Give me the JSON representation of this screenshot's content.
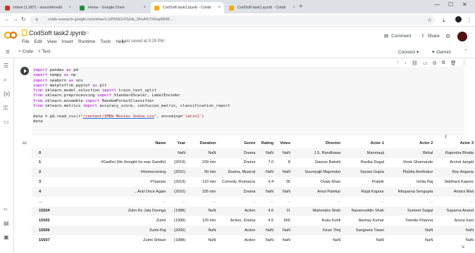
{
  "browser": {
    "tabs": [
      {
        "label": "Inbox (1,987) - ansuvbhredd",
        "fav_color": "#d93025",
        "active": false
      },
      {
        "label": "Home - Google Drive",
        "fav_color": "#1e8e3e",
        "active": false
      },
      {
        "label": "CodSoft task2.ipynb - Colab",
        "fav_color": "#f9ab00",
        "active": true
      },
      {
        "label": "CodSoft task1.ipynb - Colab",
        "fav_color": "#f9ab00",
        "active": false
      }
    ],
    "new_tab_icon": "+",
    "url": "colab.research.google.com/drive/1JzPM3GVOyHb_MroAfV7rRaqAB89…",
    "window_controls": [
      "—",
      "☐",
      "✕"
    ]
  },
  "colab": {
    "logo_color": "#f9ab00",
    "notebook_title": "CodSoft task2.ipynb",
    "menu": [
      "File",
      "Edit",
      "View",
      "Insert",
      "Runtime",
      "Tools",
      "Help"
    ],
    "last_saved": "Last saved at 9:29 PM",
    "comment_label": "Comment",
    "share_label": "Share",
    "toolbar": {
      "code_label": "+ Code",
      "text_label": "+ Text",
      "connect_label": "Connect",
      "gemini_label": "Gemini"
    }
  },
  "cell": {
    "code_lines": [
      [
        {
          "t": "import",
          "c": "kw"
        },
        {
          "t": " pandas "
        },
        {
          "t": "as",
          "c": "kw"
        },
        {
          "t": " pd"
        }
      ],
      [
        {
          "t": "import",
          "c": "kw"
        },
        {
          "t": " numpy "
        },
        {
          "t": "as",
          "c": "kw"
        },
        {
          "t": " np"
        }
      ],
      [
        {
          "t": "import",
          "c": "kw"
        },
        {
          "t": " seaborn "
        },
        {
          "t": "as",
          "c": "kw"
        },
        {
          "t": " sns"
        }
      ],
      [
        {
          "t": "import",
          "c": "kw"
        },
        {
          "t": " matplotlib.pyplot "
        },
        {
          "t": "as",
          "c": "kw"
        },
        {
          "t": " plt"
        }
      ],
      [
        {
          "t": "from",
          "c": "kw"
        },
        {
          "t": " sklearn.model_selection "
        },
        {
          "t": "import",
          "c": "kw"
        },
        {
          "t": " train_test_split"
        }
      ],
      [
        {
          "t": "from",
          "c": "kw"
        },
        {
          "t": " sklearn.preprocessing "
        },
        {
          "t": "import",
          "c": "kw"
        },
        {
          "t": " StandardScaler, LabelEncoder"
        }
      ],
      [
        {
          "t": "from",
          "c": "kw"
        },
        {
          "t": " sklearn.ensemble "
        },
        {
          "t": "import",
          "c": "kw"
        },
        {
          "t": " RandomForestClassifier"
        }
      ],
      [
        {
          "t": "from",
          "c": "kw"
        },
        {
          "t": " sklearn.metrics "
        },
        {
          "t": "import",
          "c": "kw"
        },
        {
          "t": " accuracy_score, confusion_matrix, classification_report"
        }
      ],
      [
        {
          "t": ""
        }
      ],
      [
        {
          "t": "data = pd.read_csv(r"
        },
        {
          "t": "\"",
          "c": "str"
        },
        {
          "t": "/content/IMDb Movies India.csv",
          "c": "ul"
        },
        {
          "t": "\"",
          "c": "str"
        },
        {
          "t": ", encoding="
        },
        {
          "t": "'latin1'",
          "c": "str"
        },
        {
          "t": ")"
        }
      ],
      [
        {
          "t": "data"
        }
      ]
    ]
  },
  "table": {
    "columns": [
      "",
      "Name",
      "Year",
      "Duration",
      "Genre",
      "Rating",
      "Votes",
      "Director",
      "Actor 1",
      "Actor 2",
      "Actor 3"
    ],
    "rows": [
      [
        "0",
        "",
        "NaN",
        "NaN",
        "Drama",
        "NaN",
        "NaN",
        "J.S. Randhawa",
        "Manmauji",
        "Birbal",
        "Rajendra Bhatia"
      ],
      [
        "1",
        "#Gadhvi (He thought he was Gandhi)",
        "(2019)",
        "109 min",
        "Drama",
        "7.0",
        "8",
        "Gaurav Bakshi",
        "Rasika Dugal",
        "Vivek Ghamande",
        "Arvind Jangid"
      ],
      [
        "2",
        "#Homecoming",
        "(2021)",
        "90 min",
        "Drama, Musical",
        "NaN",
        "NaN",
        "Soumyajit Majumdar",
        "Sayani Gupta",
        "Plabita Borthakur",
        "Roy Angana"
      ],
      [
        "3",
        "#Yaaram",
        "(2019)",
        "110 min",
        "Comedy, Romance",
        "4.4",
        "35",
        "Ovais Khan",
        "Prateik",
        "Ishita Raj",
        "Siddhant Kapoor"
      ],
      [
        "4",
        "...And Once Again",
        "(2010)",
        "105 min",
        "Drama",
        "NaN",
        "NaN",
        "Amol Palekar",
        "Rajat Kapoor",
        "Rituparna Sengupta",
        "Antara Mali"
      ],
      [
        "...",
        "...",
        "...",
        "...",
        "...",
        "...",
        "...",
        "...",
        "...",
        "...",
        "..."
      ],
      [
        "15504",
        "Zulm Ko Jala Doonga",
        "(1988)",
        "NaN",
        "Action",
        "4.6",
        "11",
        "Mahendra Shah",
        "Naseeruddin Shah",
        "Sumeet Saigal",
        "Suparna Anand"
      ],
      [
        "15505",
        "Zulmi",
        "(1999)",
        "129 min",
        "Action, Drama",
        "4.5",
        "655",
        "Kuku Kohli",
        "Akshay Kumar",
        "Twinkle Khanna",
        "Aruna Irani"
      ],
      [
        "15506",
        "Zulmi Raj",
        "(2005)",
        "NaN",
        "Action",
        "NaN",
        "NaN",
        "Kiran Thej",
        "Sangeeta Tiwari",
        "NaN",
        "NaN"
      ],
      [
        "15507",
        "Zulmi Shikari",
        "(1988)",
        "NaN",
        "Action",
        "NaN",
        "NaN",
        "NaN",
        "NaN",
        "NaN",
        "NaN"
      ]
    ]
  }
}
